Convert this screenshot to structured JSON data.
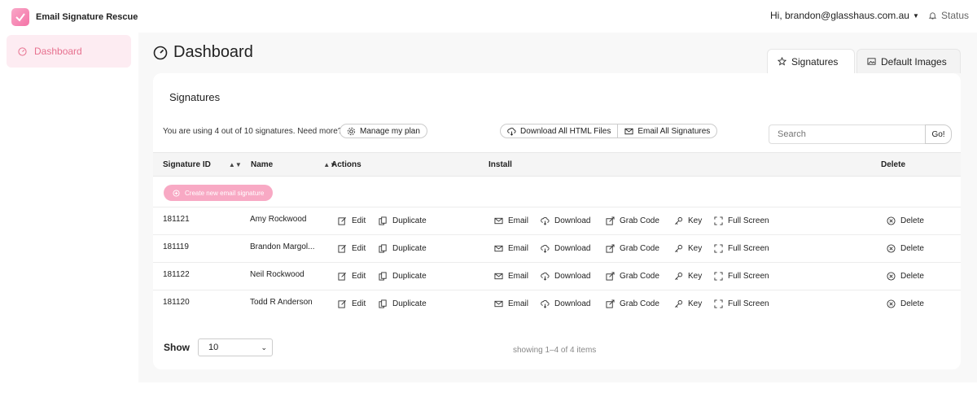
{
  "brand": {
    "name": "Email Signature Rescue"
  },
  "sidebar": {
    "items": [
      {
        "label": "Dashboard",
        "icon": "gauge-icon"
      }
    ]
  },
  "topbar": {
    "user": "Hi, brandon@glasshaus.com.au",
    "status": "Status"
  },
  "page": {
    "title": "Dashboard"
  },
  "tabs": [
    {
      "label": "Signatures",
      "icon": "star-icon"
    },
    {
      "label": "Default Images",
      "icon": "image-icon"
    }
  ],
  "card": {
    "title": "Signatures",
    "usage_text": "You are using 4 out of 10 signatures. Need more?",
    "manage_plan": "Manage my plan",
    "download_all": "Download All HTML Files",
    "email_all": "Email All Signatures",
    "search_placeholder": "Search",
    "search_go": "Go!",
    "create_button": "Create new email signature"
  },
  "table": {
    "headers": {
      "id": "Signature ID",
      "name": "Name",
      "actions": "Actions",
      "install": "Install",
      "delete": "Delete"
    },
    "action_labels": {
      "edit": "Edit",
      "duplicate": "Duplicate",
      "email": "Email",
      "download": "Download",
      "grab_code": "Grab Code",
      "key": "Key",
      "full_screen": "Full Screen",
      "delete": "Delete"
    },
    "rows": [
      {
        "id": "181121",
        "name": "Amy Rockwood"
      },
      {
        "id": "181119",
        "name": "Brandon Margol..."
      },
      {
        "id": "181122",
        "name": "Neil Rockwood"
      },
      {
        "id": "181120",
        "name": "Todd R Anderson"
      }
    ]
  },
  "footer": {
    "show_label": "Show",
    "show_value": "10",
    "showing": "showing 1–4 of 4 items"
  },
  "colors": {
    "accent": "#e7718f",
    "accent_bg": "#fdecf2",
    "create_button": "#f8a9c4"
  }
}
